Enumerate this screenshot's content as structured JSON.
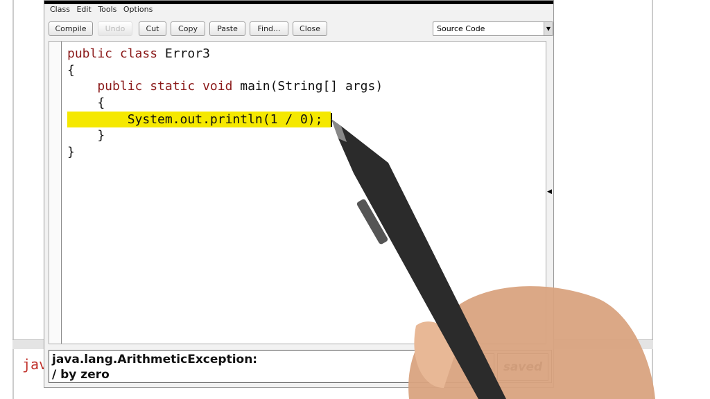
{
  "background": {
    "text": "jav"
  },
  "menu": [
    "Class",
    "Edit",
    "Tools",
    "Options"
  ],
  "toolbar": {
    "compile": "Compile",
    "undo": "Undo",
    "cut": "Cut",
    "copy": "Copy",
    "paste": "Paste",
    "find": "Find...",
    "close": "Close",
    "view_select": "Source Code"
  },
  "code": {
    "l1a": "public class ",
    "l1b": "Error3",
    "l2": "{",
    "l3a": "    public static void ",
    "l3b": "main(String[] args)",
    "l4": "    {",
    "l5": "        System.out.println(1 / 0);",
    "l6": "    }",
    "l7": "}"
  },
  "message": {
    "line1": "java.lang.ArithmeticException:",
    "line2": "/ by zero",
    "help": "?",
    "status": "saved"
  },
  "colors": {
    "highlight": "#f5e800",
    "keyword": "#8b1a1a"
  }
}
